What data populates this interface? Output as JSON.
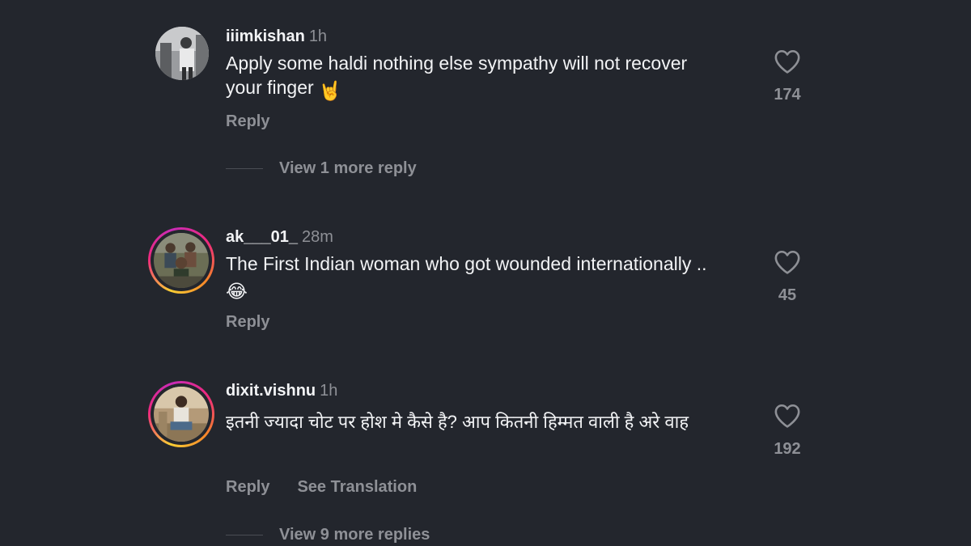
{
  "comments": [
    {
      "username": "iiimkishan",
      "time": "1h",
      "text": "Apply some haldi nothing else sympathy will not recover your finger",
      "emoji": "🤘",
      "reply_label": "Reply",
      "likes": "174",
      "view_more": "View 1 more reply"
    },
    {
      "username": "ak___01_",
      "time": "28m",
      "text": "The First Indian woman who got wounded internationally ..",
      "emoji": "😂",
      "reply_label": "Reply",
      "likes": "45"
    },
    {
      "username": "dixit.vishnu",
      "time": "1h",
      "text": "इतनी ज्यादा चोट पर होश मे कैसे है? आप कितनी हिम्मत वाली है अरे वाह",
      "reply_label": "Reply",
      "translation_label": "See Translation",
      "likes": "192",
      "view_more": "View 9 more replies"
    }
  ],
  "icons": {
    "like": "heart-outline-icon"
  },
  "colors": {
    "background": "#23262d",
    "primary_text": "#f2f3f5",
    "secondary_text": "#8e9096",
    "story_ring_start": "#f9ce34",
    "story_ring_end": "#ee2a7b"
  }
}
